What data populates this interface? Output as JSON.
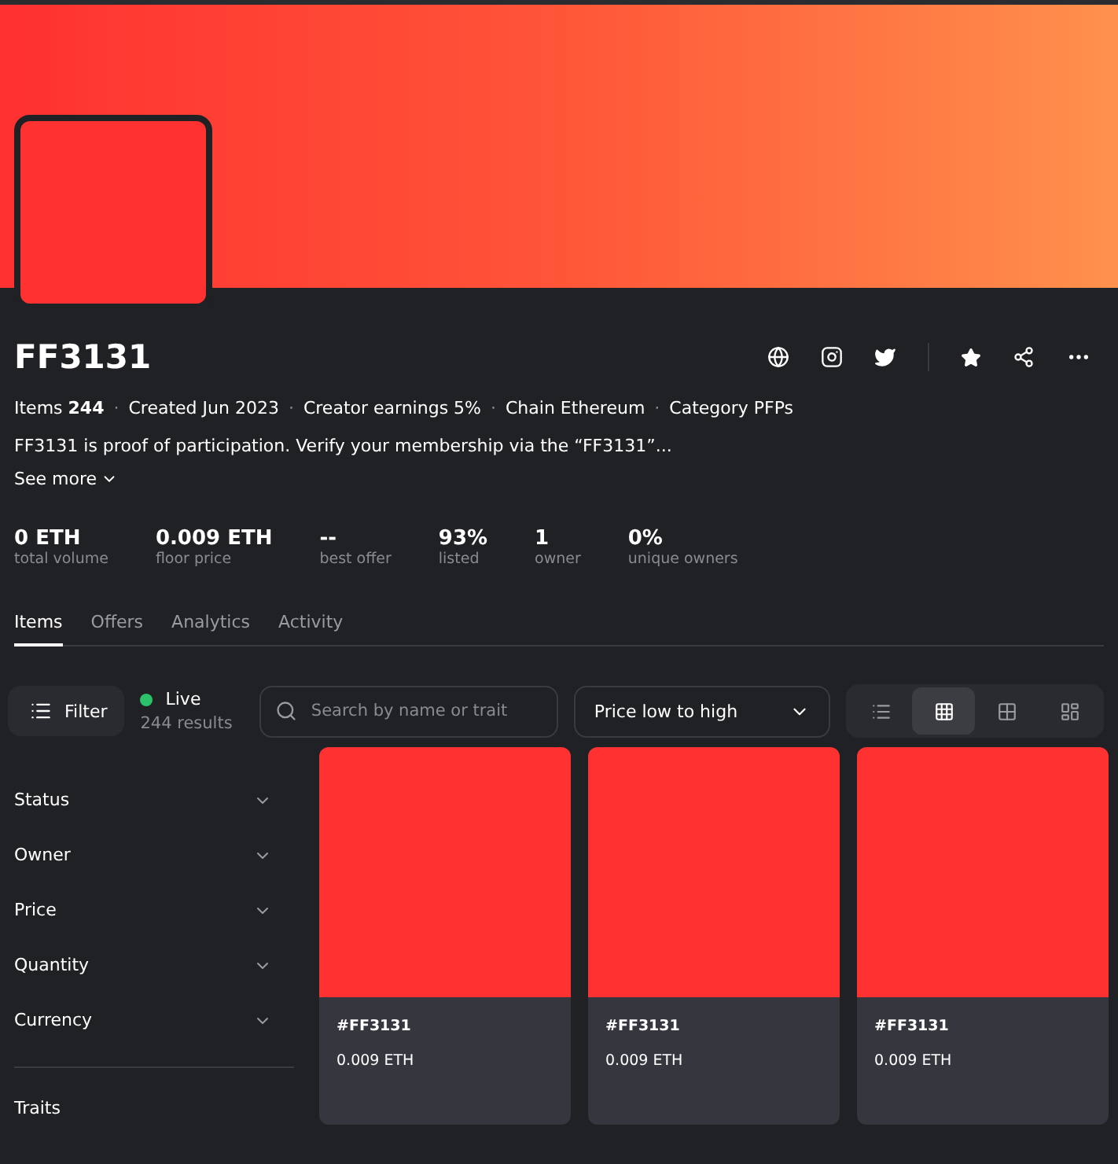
{
  "collection": {
    "name": "FF3131",
    "separator": "·",
    "meta": [
      "Items **244**",
      "Created Jun 2023",
      "Creator earnings 5%",
      "Chain Ethereum",
      "Category PFPs"
    ],
    "description": "FF3131 is proof of participation. Verify your membership via the “FF3131”...",
    "see_more": "See more"
  },
  "stats": [
    {
      "value": "0 ETH",
      "label": "total volume"
    },
    {
      "value": "0.009 ETH",
      "label": "floor price"
    },
    {
      "value": "--",
      "label": "best offer"
    },
    {
      "value": "93%",
      "label": "listed"
    },
    {
      "value": "1",
      "label": "owner"
    },
    {
      "value": "0%",
      "label": "unique owners"
    }
  ],
  "tabs": [
    {
      "label": "Items",
      "selected": true
    },
    {
      "label": "Offers",
      "selected": false
    },
    {
      "label": "Analytics",
      "selected": false
    },
    {
      "label": "Activity",
      "selected": false
    }
  ],
  "toolbar": {
    "filter": "Filter",
    "status": {
      "label": "Live",
      "color": "#2bc26b"
    },
    "results": "244 results",
    "search": {
      "placeholder": "Search by name or trait"
    },
    "sort": "Price low to high",
    "views": [
      {
        "kind": "list",
        "selected": false
      },
      {
        "kind": "grid",
        "selected": true
      },
      {
        "kind": "large",
        "selected": false
      },
      {
        "kind": "mosaic",
        "selected": false
      }
    ]
  },
  "filters": [
    "Status",
    "Owner",
    "Price",
    "Quantity",
    "Currency"
  ],
  "traits": "Traits",
  "items": [
    {
      "name": "#FF3131",
      "price": "0.009 ETH"
    },
    {
      "name": "#FF3131",
      "price": "0.009 ETH"
    },
    {
      "name": "#FF3131",
      "price": "0.009 ETH"
    }
  ]
}
